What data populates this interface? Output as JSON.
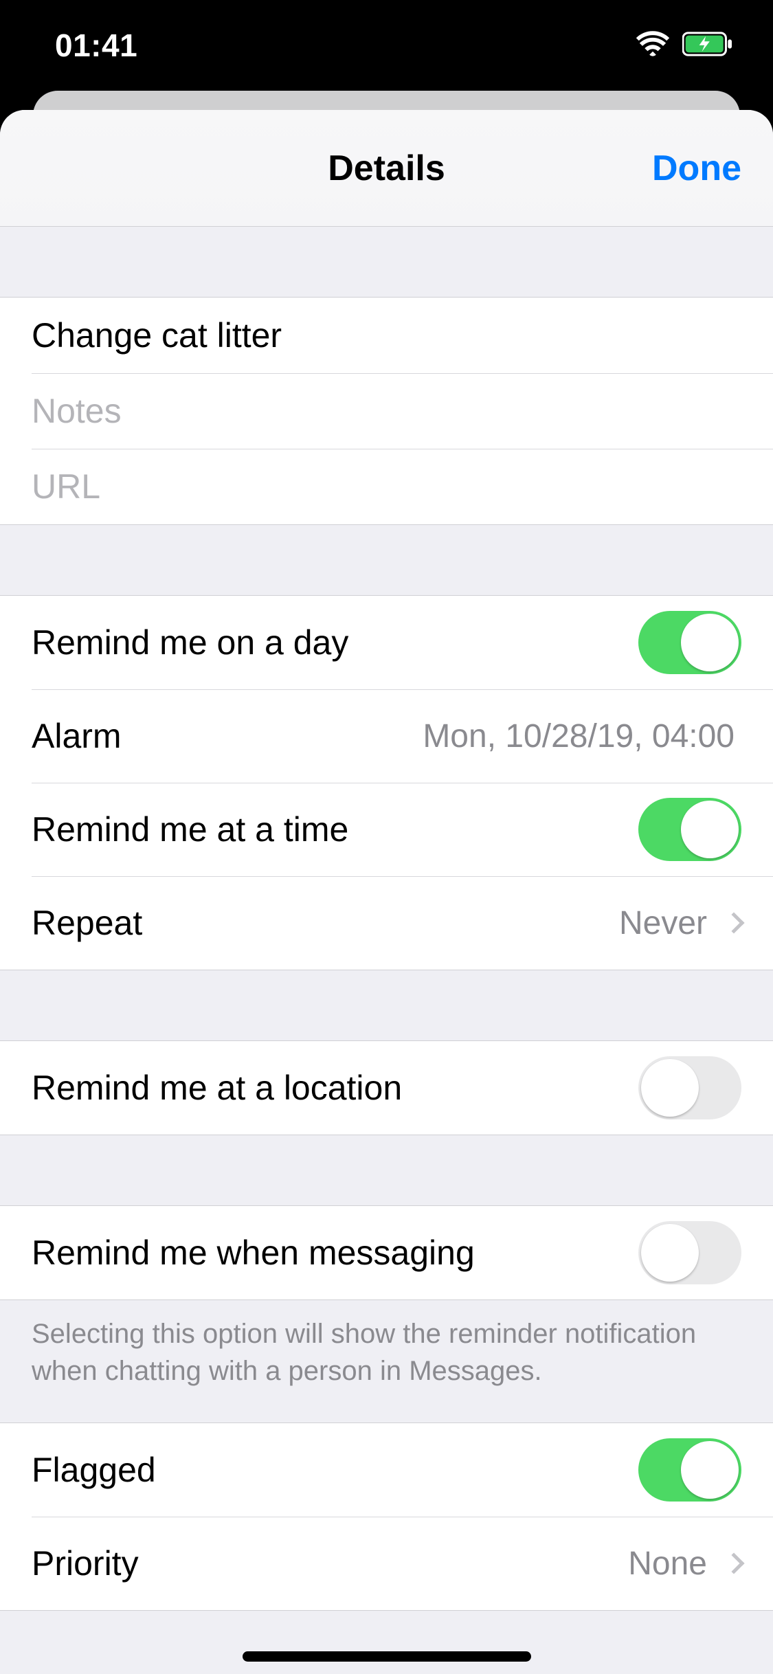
{
  "status": {
    "time": "01:41"
  },
  "nav": {
    "title": "Details",
    "done": "Done"
  },
  "fields": {
    "title_value": "Change cat litter",
    "notes_placeholder": "Notes",
    "url_placeholder": "URL"
  },
  "rows": {
    "remind_day": "Remind me on a day",
    "alarm_label": "Alarm",
    "alarm_value": "Mon, 10/28/19, 04:00",
    "remind_time": "Remind me at a time",
    "repeat_label": "Repeat",
    "repeat_value": "Never",
    "remind_location": "Remind me at a location",
    "remind_messaging": "Remind me when messaging",
    "messaging_footer": "Selecting this option will show the reminder notification when chatting with a person in Messages.",
    "flagged": "Flagged",
    "priority_label": "Priority",
    "priority_value": "None"
  },
  "toggles": {
    "remind_day": true,
    "remind_time": true,
    "remind_location": false,
    "remind_messaging": false,
    "flagged": true
  }
}
